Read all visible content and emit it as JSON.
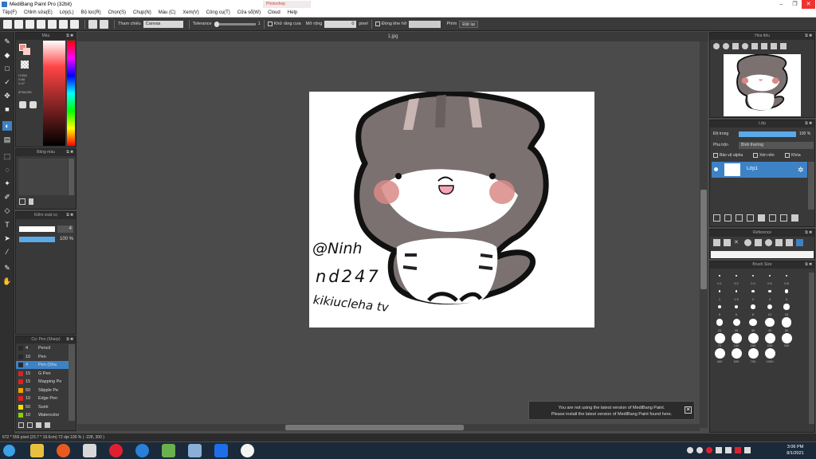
{
  "window": {
    "title": "MediBang Paint Pro (32bit)",
    "other_tab": "Photoshop"
  },
  "menu": [
    "Tệp(F)",
    "Chỉnh sửa(E)",
    "Lớp(L)",
    "Bộ lọc(R)",
    "Chọn(S)",
    "Chụp(N)",
    "Màu (C)",
    "Xem(V)",
    "Công cụ(T)",
    "Cửa sổ(W)",
    "Cloud",
    "Help"
  ],
  "toolbar": {
    "ref_label": "Tham chiếu",
    "ref_value": "Canvas",
    "tolerance_label": "Tolerance",
    "tolerance_value": "1",
    "antialias_label": "Khử răng cưa",
    "expand_label": "Mở rộng",
    "expand_value": "0",
    "pixel_label": "pixel",
    "close_gap_label": "Đóng khe hở",
    "mode_label": "Phím",
    "off_label": "Đặt lại"
  },
  "document": {
    "tab_title": "1.jpg"
  },
  "color_panel": {
    "title": "Màu",
    "hsv": "H:358\nS:68\nV:47",
    "hex": "#F8A29D"
  },
  "palette_panel": {
    "title": "Bảng màu"
  },
  "brush_ctrl_panel": {
    "title": "Kiểm soát cọ",
    "size_value": "4",
    "opacity_value": "100 %"
  },
  "brush_panel": {
    "title": "Cọ: Pen (Sharp)",
    "items": [
      {
        "size": "4",
        "name": "Pencil",
        "color": "#2a2a2a"
      },
      {
        "size": "10",
        "name": "Pen",
        "color": "#2a2a2a"
      },
      {
        "size": "4",
        "name": "Pen (Sha",
        "color": "#2a2a2a"
      },
      {
        "size": "15",
        "name": "G Pen",
        "color": "#e02020"
      },
      {
        "size": "15",
        "name": "Mapping Pe",
        "color": "#e02020"
      },
      {
        "size": "50",
        "name": "Stipple Pe",
        "color": "#f0a000"
      },
      {
        "size": "10",
        "name": "Edge Pen",
        "color": "#e02020"
      },
      {
        "size": "50",
        "name": "Sumi",
        "color": "#f0e000"
      },
      {
        "size": "10",
        "name": "Watercolor",
        "color": "#8ad000"
      }
    ]
  },
  "navigator": {
    "title": "Hoa tiêu"
  },
  "layer_panel": {
    "title": "Lớp",
    "opacity_label": "Độ trong",
    "opacity_value": "100 %",
    "blend_label": "Pha trộn",
    "blend_value": "Bình thường",
    "protect_alpha": "Bảo vệ alpha",
    "clipping": "Xén nền",
    "lock": "Khóa",
    "layer_name": "Lớp1"
  },
  "reference_panel": {
    "title": "Reference"
  },
  "brush_size_panel": {
    "title": "Brush Size",
    "sizes": [
      "0.1",
      "0.2",
      "0.4",
      "0.6",
      "0.8",
      "1",
      "1.5",
      "2",
      "3",
      "4",
      "5",
      "6",
      "8",
      "12",
      "15",
      "20",
      "25",
      "30",
      "40",
      "50",
      "70",
      "100",
      "150",
      "200",
      "300",
      "400",
      "500",
      "700",
      "1000"
    ]
  },
  "notice": {
    "line1": "You are not using the latest version of MediBang Paint.",
    "line2": "Please install the latest version of MediBang Paint found here."
  },
  "status": "672 * 556 pixel  (23.7 * 19.6cm)  72 dpi  100 %  ( -228, 300 )",
  "handwriting": [
    "@Ninh",
    "nd247",
    "kikiucleha tv"
  ],
  "clock": {
    "time": "3:06 PM",
    "date": "8/1/2021"
  },
  "colors": {
    "accent": "#3e82c6",
    "panel": "#393939",
    "canvas_bg": "#4b4b4b"
  }
}
